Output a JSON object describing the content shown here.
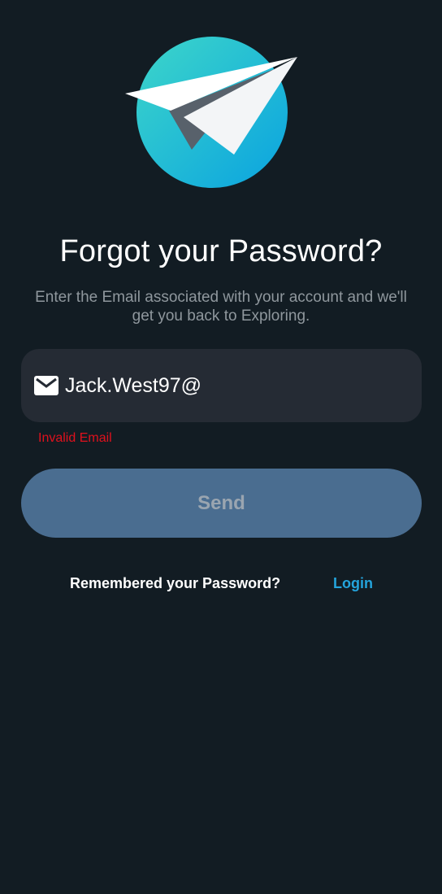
{
  "logo": {
    "icon": "paper-plane-icon",
    "colors": {
      "circle_start": "#3dd6c9",
      "circle_end": "#0aa3e0",
      "plane": "#ffffff",
      "shadow": "#58616b"
    }
  },
  "header": {
    "title": "Forgot your Password?",
    "subtitle": "Enter the Email associated with your account and we'll get you back to Exploring."
  },
  "form": {
    "email_icon": "mail-icon",
    "email_value": "Jack.West97@",
    "error_text": "Invalid Email",
    "send_label": "Send"
  },
  "footer": {
    "remember_text": "Remembered your Password?",
    "login_label": "Login"
  },
  "colors": {
    "background": "#121c23",
    "input_bg": "#252b34",
    "button_bg": "#4a6d90",
    "error": "#e0111d",
    "link": "#24a4dc"
  }
}
